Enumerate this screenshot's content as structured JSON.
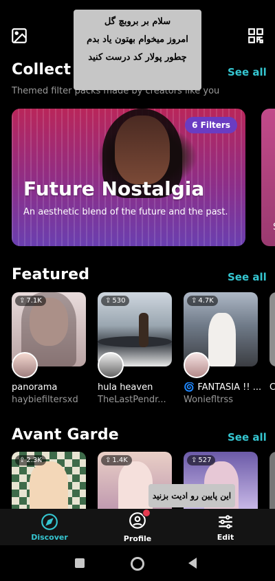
{
  "top_bar": {
    "left_icon": "image-icon",
    "right_icon": "qr-code-icon"
  },
  "overlay_note": {
    "lines": [
      "سلام بر بروبچ گل",
      "امروز میخوام بهتون یاد بدم",
      "چطور پولار کد درست کنید"
    ]
  },
  "collections": {
    "title": "Collect",
    "see_all": "See all",
    "subtitle": "Themed filter packs made by creators like you",
    "hero": {
      "badge": "6 Filters",
      "title": "Future Nostalgia",
      "description": "An aesthetic blend of the future and the past."
    },
    "peek_text": "S"
  },
  "featured": {
    "title": "Featured",
    "see_all": "See all",
    "items": [
      {
        "count": "7.1K",
        "title": "panorama",
        "author": "haybiefiltersxd"
      },
      {
        "count": "530",
        "title": "hula heaven",
        "author": "TheLastPendr..."
      },
      {
        "count": "4.7K",
        "title": "🌀 FANTASIA !! ...",
        "author": "Woniefltrss"
      }
    ],
    "peek": "C"
  },
  "avant_garde": {
    "title": "Avant Garde",
    "see_all": "See all",
    "items": [
      {
        "count": "2.3K"
      },
      {
        "count": "1.4K"
      },
      {
        "count": "527"
      }
    ]
  },
  "tooltip": {
    "text": "این پایین رو ادیت بزنید"
  },
  "bottom_nav": {
    "items": [
      {
        "label": "Discover",
        "icon": "compass-icon",
        "active": true
      },
      {
        "label": "Profile",
        "icon": "profile-icon",
        "active": false
      },
      {
        "label": "Edit",
        "icon": "sliders-icon",
        "active": false
      }
    ]
  },
  "colors": {
    "accent": "#35c6d1",
    "hero_badge": "#6a3cc2",
    "notification_dot": "#e53b50"
  }
}
